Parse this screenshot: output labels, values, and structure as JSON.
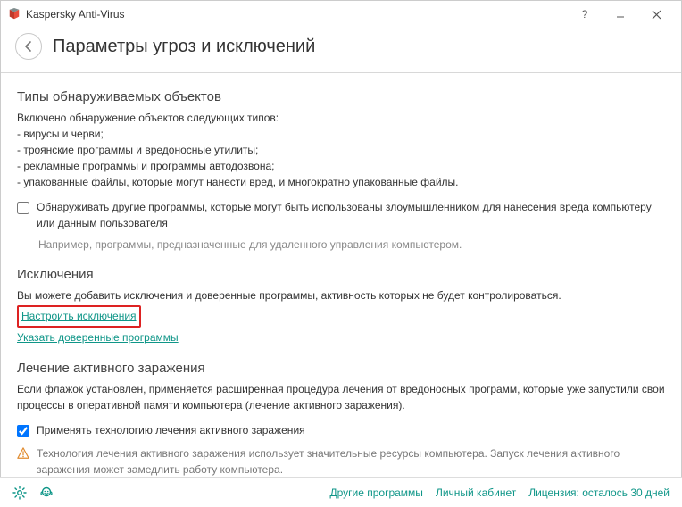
{
  "titlebar": {
    "app_name": "Kaspersky Anti-Virus"
  },
  "header": {
    "page_title": "Параметры угроз и исключений"
  },
  "types": {
    "title": "Типы обнаруживаемых объектов",
    "intro": "Включено обнаружение объектов следующих типов:",
    "b1": "- вирусы и черви;",
    "b2": "- троянские программы и вредоносные утилиты;",
    "b3": "- рекламные программы и программы автодозвона;",
    "b4": "- упакованные файлы, которые могут нанести вред, и многократно упакованные файлы.",
    "checkbox_label": "Обнаруживать другие программы, которые могут быть использованы злоумышленником для нанесения вреда компьютеру или данным пользователя",
    "hint": "Например, программы, предназначенные для удаленного управления компьютером."
  },
  "exclusions": {
    "title": "Исключения",
    "intro": "Вы можете добавить исключения и доверенные программы, активность которых не будет контролироваться.",
    "link_configure": "Настроить исключения",
    "link_trusted": "Указать доверенные программы"
  },
  "active": {
    "title": "Лечение активного заражения",
    "intro": "Если флажок установлен, применяется расширенная процедура лечения от вредоносных программ, которые уже запустили свои процессы в оперативной памяти компьютера (лечение активного заражения).",
    "checkbox_label": "Применять технологию лечения активного заражения",
    "warn": "Технология лечения активного заражения использует значительные ресурсы компьютера. Запуск лечения активного заражения может замедлить работу компьютера."
  },
  "footer": {
    "other": "Другие программы",
    "account": "Личный кабинет",
    "license": "Лицензия: осталось 30 дней"
  }
}
